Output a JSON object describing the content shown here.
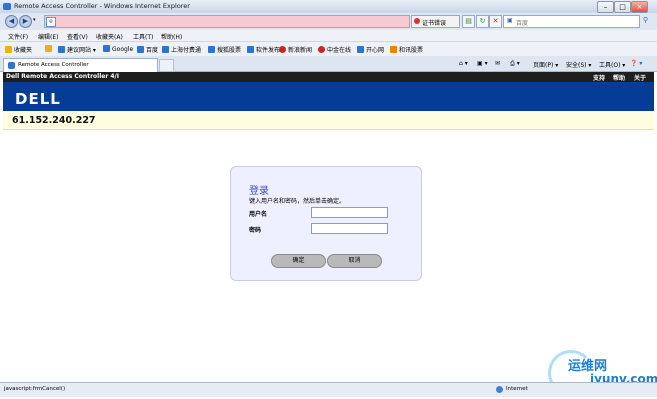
{
  "window": {
    "title": "Remote Access Controller - Windows Internet Explorer"
  },
  "address": {
    "url": "",
    "cert_label": "证书错误",
    "search_placeholder": "百度"
  },
  "menus": [
    "文件(F)",
    "编辑(E)",
    "查看(V)",
    "收藏夹(A)",
    "工具(T)",
    "帮助(H)"
  ],
  "favorites": {
    "label": "收藏夹",
    "items": [
      "建议网站 ▾",
      "Google",
      "百度",
      "上海付费通",
      "搜狐股票",
      "软件发布",
      "新浪新闻",
      "中金在线",
      "开心网",
      "和讯股票"
    ]
  },
  "tab": {
    "title": "Remote Access Controller"
  },
  "toolbar": {
    "page": "页面(P) ▾",
    "safety": "安全(S) ▾",
    "tools": "工具(O) ▾"
  },
  "drac": {
    "header_title": "Dell Remote Access Controller 4/I",
    "links": [
      "支持",
      "帮助",
      "关于"
    ],
    "logo": "DELL",
    "ip": "61.152.240.227"
  },
  "login": {
    "title": "登录",
    "subtitle": "键入用户名和密码，然后单击确定。",
    "username_label": "用户名",
    "password_label": "密码",
    "username_value": "",
    "password_value": "",
    "ok": "确定",
    "cancel": "取消"
  },
  "status": {
    "text": "javascript:frmCancel()",
    "zone": "Internet"
  },
  "watermark": {
    "line1": "运维网",
    "line2": "iyunv.com"
  }
}
